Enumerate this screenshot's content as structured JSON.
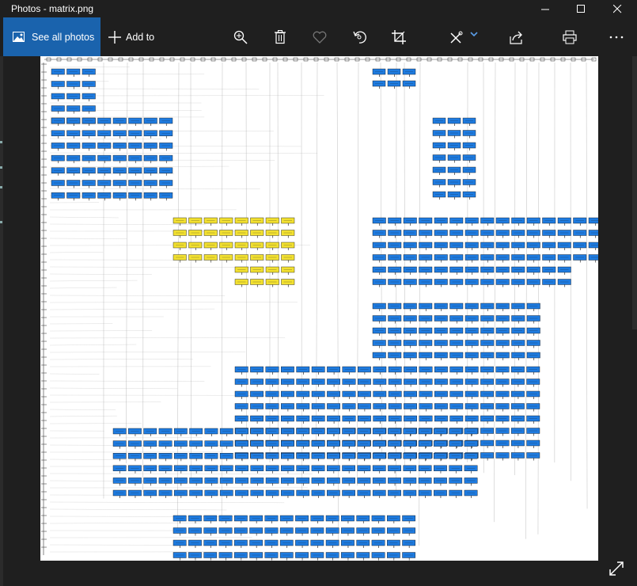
{
  "window": {
    "title": "Photos - matrix.png"
  },
  "toolbar": {
    "see_all_photos_label": "See all photos",
    "add_to_label": "Add to",
    "icons": [
      "zoom-in-icon",
      "delete-icon",
      "favorite-icon",
      "rotate-icon",
      "crop-icon",
      "edit-icon",
      "chevron-down-icon",
      "share-icon",
      "print-icon",
      "more-icon"
    ]
  },
  "colors": {
    "accent": "#1a63ad",
    "cell_blue": "#1e7be0",
    "cell_yellow": "#f2e030",
    "background": "#1f1f1f"
  }
}
